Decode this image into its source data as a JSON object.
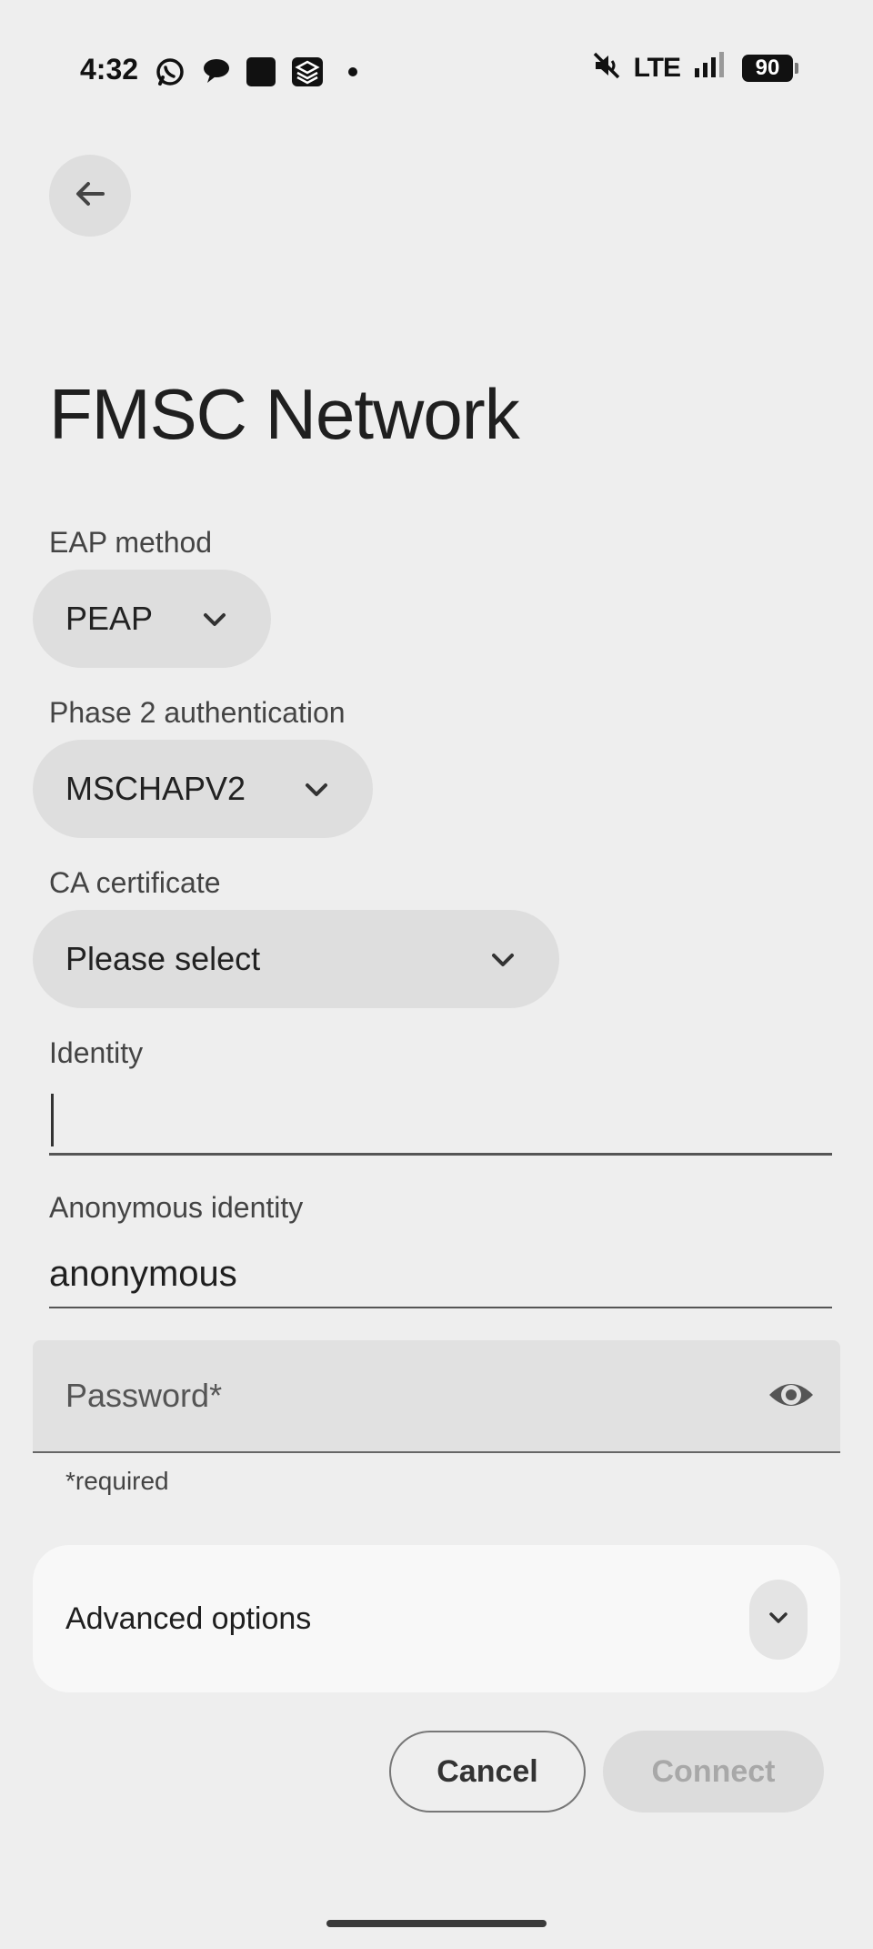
{
  "status_bar": {
    "time": "4:32",
    "notification_icons": [
      "whatsapp-icon",
      "chat-bubble-icon",
      "square-app-icon",
      "stack-app-icon",
      "dot-icon"
    ],
    "network": "LTE",
    "battery": "90",
    "mute_icon": "muted-icon"
  },
  "header": {
    "back_icon": "back-arrow-icon"
  },
  "page": {
    "title": "FMSC Network"
  },
  "form": {
    "eap_method": {
      "label": "EAP method",
      "value": "PEAP"
    },
    "phase2": {
      "label": "Phase 2 authentication",
      "value": "MSCHAPV2"
    },
    "ca_certificate": {
      "label": "CA certificate",
      "value": "Please select"
    },
    "identity": {
      "label": "Identity",
      "value": ""
    },
    "anonymous_identity": {
      "label": "Anonymous identity",
      "value": "anonymous"
    },
    "password": {
      "placeholder": "Password*",
      "required_note": "*required"
    },
    "advanced": {
      "label": "Advanced options"
    }
  },
  "actions": {
    "cancel_label": "Cancel",
    "connect_label": "Connect"
  },
  "colors": {
    "background": "#eeeeee",
    "dropdown_bg": "#dedede",
    "card_bg": "#f8f8f8",
    "disabled_text": "#a8a8a8"
  }
}
